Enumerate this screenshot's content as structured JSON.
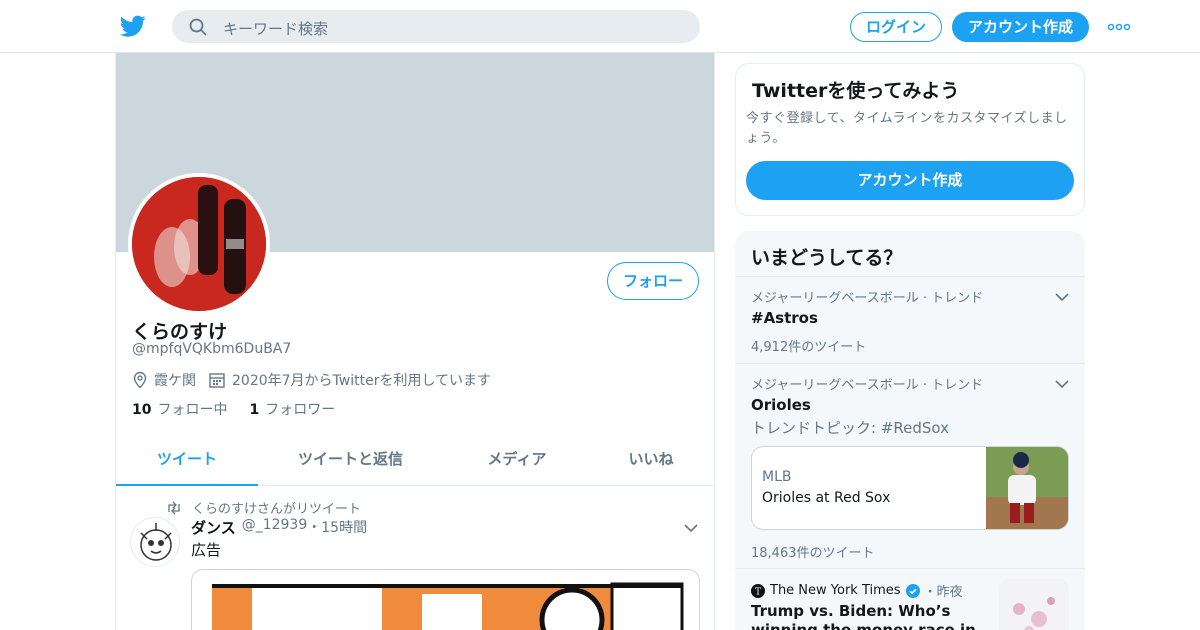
{
  "header": {
    "search_placeholder": "キーワード検索",
    "login_label": "ログイン",
    "signup_label": "アカウント作成"
  },
  "profile": {
    "follow_label": "フォロー",
    "name": "くらのすけ",
    "handle": "@mpfqVQKbm6DuBA7",
    "location": "霞ケ関",
    "joined": "2020年7月からTwitterを利用しています",
    "following_count": "10",
    "following_label": "フォロー中",
    "followers_count": "1",
    "followers_label": "フォロワー"
  },
  "tabs": [
    {
      "label": "ツイート"
    },
    {
      "label": "ツイートと返信"
    },
    {
      "label": "メディア"
    },
    {
      "label": "いいね"
    }
  ],
  "tweet": {
    "retweet_text": "くらのすけさんがリツイート",
    "author_name": "ダンス",
    "author_handle": "@_12939",
    "time": "・15時間",
    "body": "広告"
  },
  "sidebar": {
    "signup_box": {
      "title": "Twitterを使ってみよう",
      "text": "今すぐ登録して、タイムラインをカスタマイズしましょう。",
      "button": "アカウント作成"
    },
    "trends": {
      "title": "いまどうしてる？",
      "items": [
        {
          "context": "メジャーリーグベースボール · トレンド",
          "name": "#Astros",
          "count": "4,912件のツイート"
        },
        {
          "context": "メジャーリーグベースボール · トレンド",
          "name": "Orioles",
          "topic": "トレンドトピック: #RedSox",
          "card_source": "MLB",
          "card_title": "Orioles at Red Sox",
          "count": "18,463件のツイート"
        }
      ],
      "news": {
        "source": "The New York Times",
        "time": "・昨夜",
        "headline": "Trump vs. Biden: Who’s winning the money race in your ZIP code?"
      }
    }
  },
  "colors": {
    "accent": "#1da1f2",
    "banner": "#ccd6dd",
    "muted": "#657786"
  }
}
